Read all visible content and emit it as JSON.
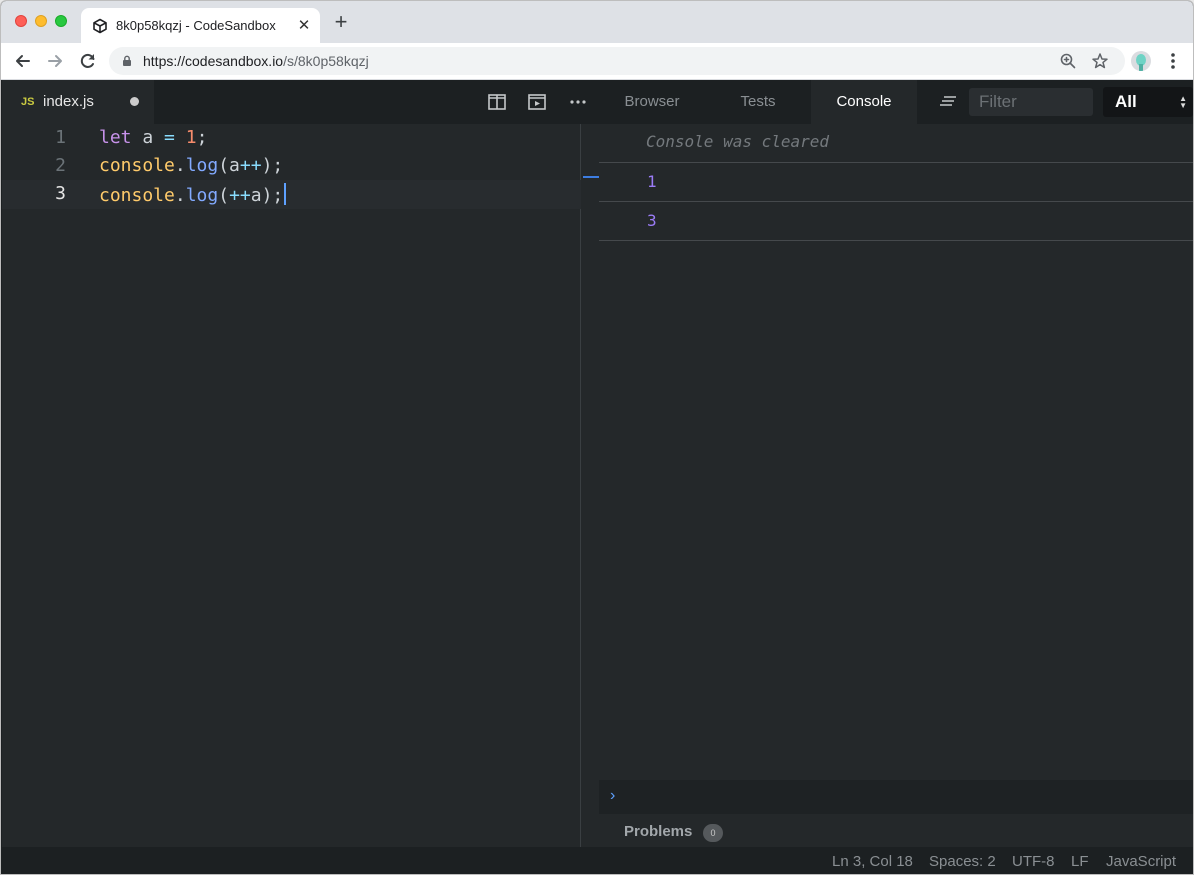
{
  "browser": {
    "tab_title": "8k0p58kqzj - CodeSandbox",
    "url_host": "https://codesandbox.io",
    "url_path": "/s/8k0p58kqzj"
  },
  "editor": {
    "file_tab": {
      "badge": "JS",
      "name": "index.js"
    },
    "lines": [
      {
        "num": "1",
        "tokens": [
          {
            "t": "let",
            "c": "kw"
          },
          {
            "t": " a ",
            "c": ""
          },
          {
            "t": "=",
            "c": "op"
          },
          {
            "t": " ",
            "c": ""
          },
          {
            "t": "1",
            "c": "num"
          },
          {
            "t": ";",
            "c": ""
          }
        ]
      },
      {
        "num": "2",
        "tokens": [
          {
            "t": "console",
            "c": "obj"
          },
          {
            "t": ".",
            "c": ""
          },
          {
            "t": "log",
            "c": "fn"
          },
          {
            "t": "(a",
            "c": ""
          },
          {
            "t": "++",
            "c": "op"
          },
          {
            "t": ");",
            "c": ""
          }
        ]
      },
      {
        "num": "3",
        "tokens": [
          {
            "t": "console",
            "c": "obj"
          },
          {
            "t": ".",
            "c": ""
          },
          {
            "t": "log",
            "c": "fn"
          },
          {
            "t": "(",
            "c": ""
          },
          {
            "t": "++",
            "c": "op"
          },
          {
            "t": "a);",
            "c": ""
          }
        ]
      }
    ]
  },
  "preview_tabs": [
    {
      "label": "Browser",
      "active": false
    },
    {
      "label": "Tests",
      "active": false
    },
    {
      "label": "Console",
      "active": true
    }
  ],
  "console": {
    "filter_placeholder": "Filter",
    "level": "All",
    "cleared_message": "Console was cleared",
    "outputs": [
      "1",
      "3"
    ]
  },
  "problems": {
    "label": "Problems",
    "count": "0"
  },
  "status": {
    "position": "Ln 3, Col 18",
    "spaces": "Spaces: 2",
    "encoding": "UTF-8",
    "eol": "LF",
    "language": "JavaScript"
  },
  "colors": {
    "accent": "#5ea1ff",
    "console_number": "#9b7cf7",
    "keyword": "#c792ea",
    "number": "#f78c6c",
    "operator": "#89ddff",
    "object": "#ffcb6b",
    "function": "#82aaff"
  },
  "icons": [
    "codesandbox-icon",
    "close-icon",
    "plus-icon",
    "back-arrow-icon",
    "forward-arrow-icon",
    "reload-icon",
    "lock-icon",
    "zoom-icon",
    "star-icon",
    "profile-avatar-icon",
    "kebab-menu-icon",
    "split-view-icon",
    "preview-icon",
    "more-icon",
    "clear-console-icon",
    "prompt-chevron-icon"
  ]
}
